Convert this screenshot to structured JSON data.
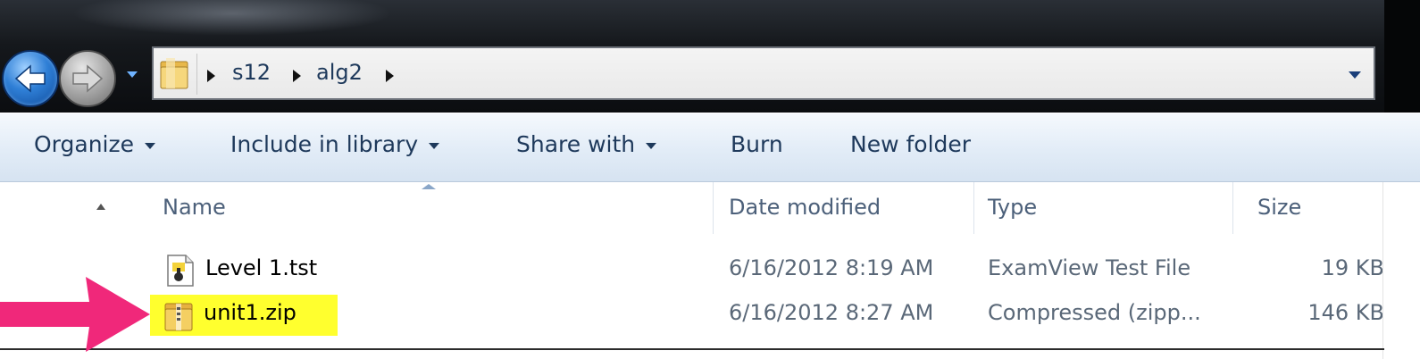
{
  "address": {
    "crumbs": [
      "s12",
      "alg2"
    ],
    "icons": {
      "back": "back-arrow-icon",
      "forward": "forward-arrow-icon",
      "location": "folder-icon"
    }
  },
  "toolbar": {
    "organize": "Organize",
    "include_in_library": "Include in library",
    "share_with": "Share with",
    "burn": "Burn",
    "new_folder": "New folder"
  },
  "columns": {
    "name": "Name",
    "date_modified": "Date modified",
    "type": "Type",
    "size": "Size"
  },
  "files": [
    {
      "name": "Level 1.tst",
      "date": "6/16/2012 8:19 AM",
      "type": "ExamView Test File",
      "size": "19 KB",
      "icon": "examview-file-icon"
    },
    {
      "name": "unit1.zip",
      "date": "6/16/2012 8:27 AM",
      "type": "Compressed (zipp...",
      "size": "146 KB",
      "icon": "zip-folder-icon",
      "highlighted": true
    }
  ],
  "annotation": {
    "arrow_color": "#f0287a",
    "highlight_color": "#ffff2e"
  }
}
